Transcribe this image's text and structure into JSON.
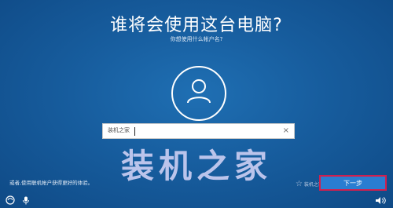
{
  "screen": {
    "title": "谁将会使用这台电脑?",
    "subtitle": "你想使用什么帐户名?"
  },
  "account_input": {
    "value": "装机之家",
    "clear_symbol": "×"
  },
  "watermark": {
    "text": "装机之家"
  },
  "footer": {
    "note": "或者,使用联机帐户获得更好的体验。",
    "next_label": "下一步",
    "site_mark": "装机之家"
  },
  "colors": {
    "background": "#175d9e",
    "button_bg": "#2a7dd1",
    "highlight_border": "#d11f4e",
    "watermark": "#c9cdf2"
  },
  "icons": {
    "avatar": "user-silhouette-icon",
    "accessibility": "ease-of-access-icon",
    "microphone": "microphone-icon",
    "volume": "volume-icon",
    "site": "star-icon"
  }
}
